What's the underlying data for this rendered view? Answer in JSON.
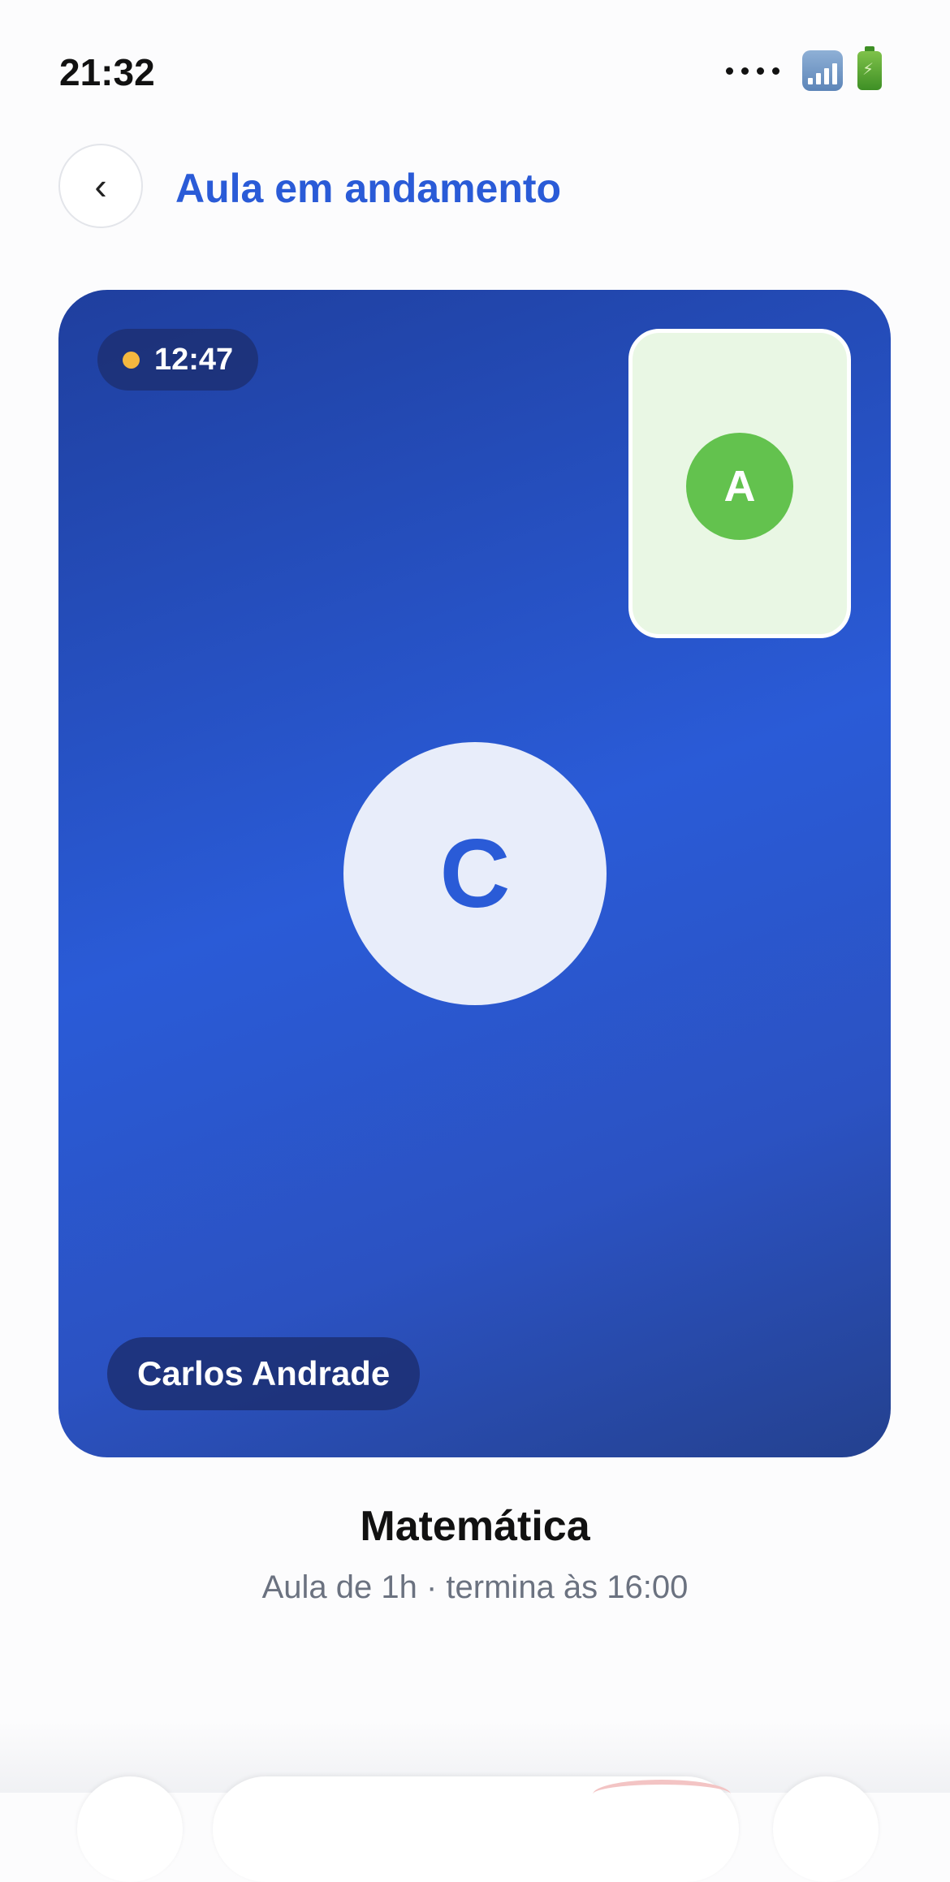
{
  "status_bar": {
    "time": "21:32",
    "signal_icon": "cellular-signal-icon",
    "battery_icon": "battery-charging-icon"
  },
  "header": {
    "back_label": "‹",
    "title": "Aula em andamento"
  },
  "call": {
    "elapsed": "12:47",
    "live_indicator_color": "#f4b73f",
    "self_initial": "A",
    "self_avatar_color": "#63c24e",
    "remote_initial": "C",
    "remote_name": "Carlos Andrade",
    "accent_color": "#2a5bd7"
  },
  "lesson": {
    "subject": "Matemática",
    "details": "Aula de 1h · termina às 16:00"
  }
}
